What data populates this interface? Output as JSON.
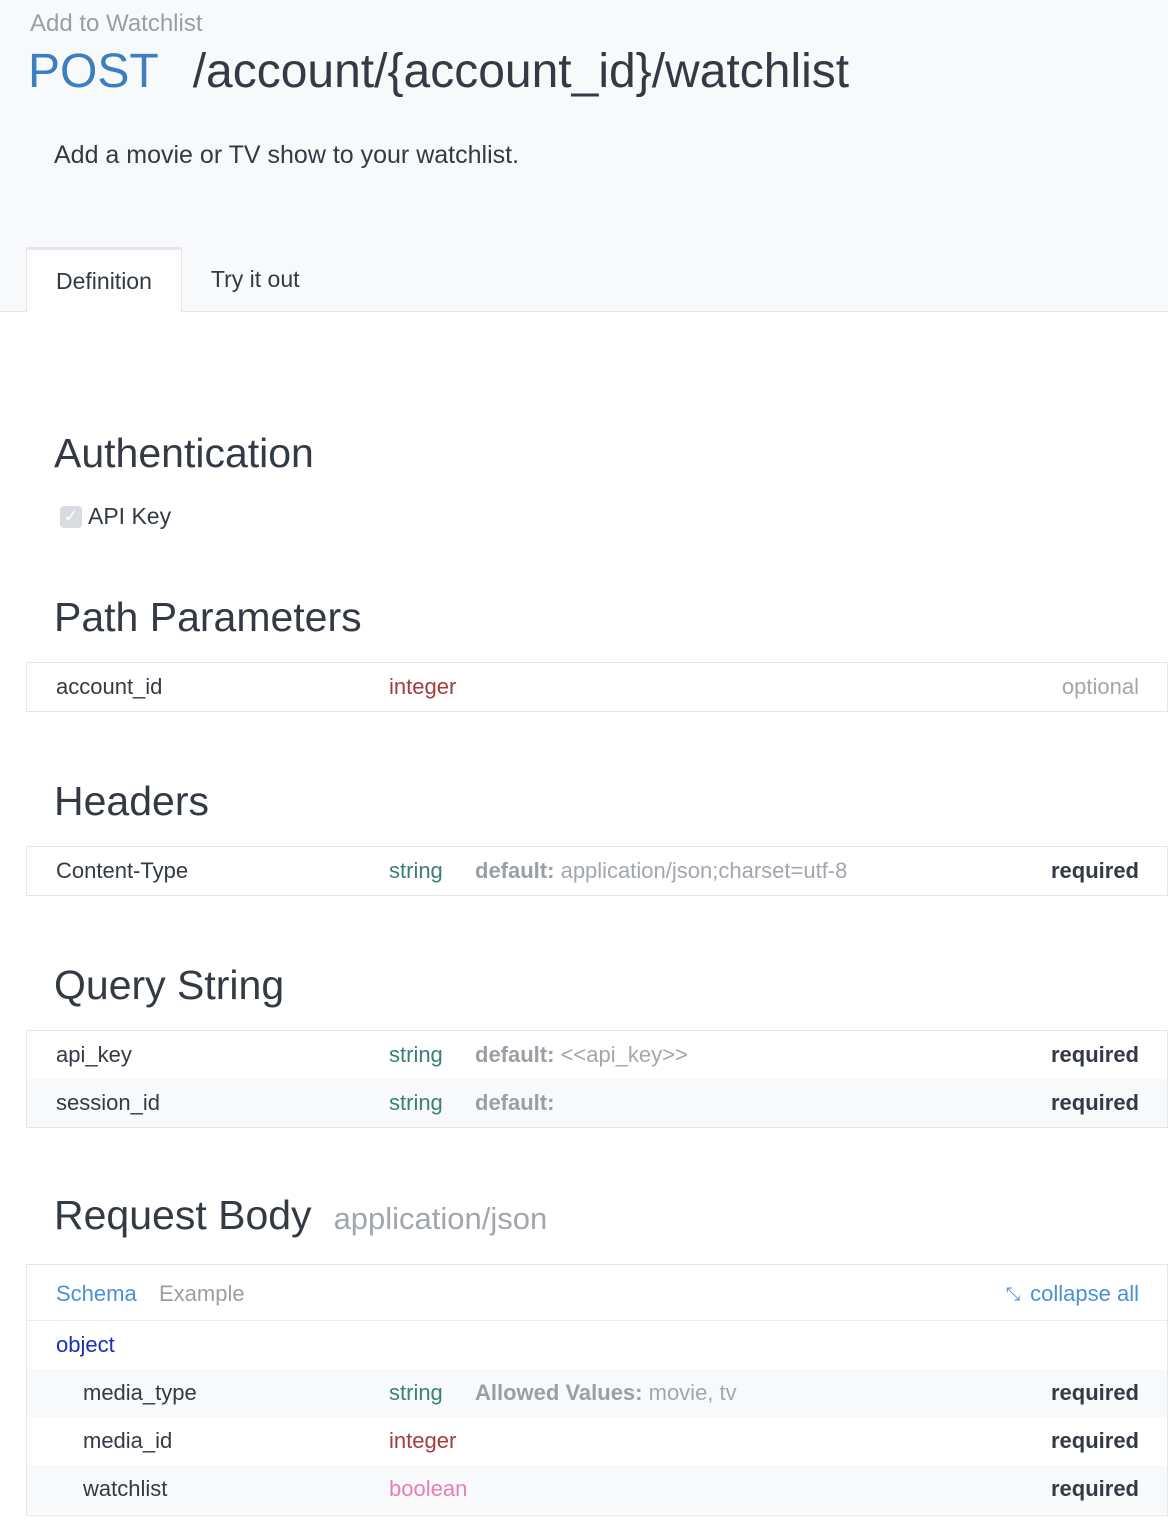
{
  "breadcrumb": "Add to Watchlist",
  "endpoint": {
    "method": "POST",
    "path": "/account/{account_id}/watchlist"
  },
  "description": "Add a movie or TV show to your watchlist.",
  "tabs": [
    {
      "label": "Definition",
      "active": true
    },
    {
      "label": "Try it out",
      "active": false
    }
  ],
  "authentication": {
    "title": "Authentication",
    "item": "API Key"
  },
  "path_parameters": {
    "title": "Path Parameters",
    "rows": [
      {
        "name": "account_id",
        "type": "integer",
        "default_label": "",
        "default_value": "",
        "status": "optional"
      }
    ]
  },
  "headers": {
    "title": "Headers",
    "rows": [
      {
        "name": "Content-Type",
        "type": "string",
        "default_label": "default:",
        "default_value": "application/json;charset=utf-8",
        "status": "required"
      }
    ]
  },
  "query_string": {
    "title": "Query String",
    "rows": [
      {
        "name": "api_key",
        "type": "string",
        "default_label": "default:",
        "default_value": "<<api_key>>",
        "status": "required"
      },
      {
        "name": "session_id",
        "type": "string",
        "default_label": "default:",
        "default_value": "",
        "status": "required"
      }
    ]
  },
  "request_body": {
    "title": "Request Body",
    "content_type": "application/json",
    "schema_tab": "Schema",
    "example_tab": "Example",
    "collapse_all": "collapse all",
    "object_label": "object",
    "fields": [
      {
        "name": "media_type",
        "type": "string",
        "allowed_label": "Allowed Values:",
        "allowed_values": "movie, tv",
        "status": "required"
      },
      {
        "name": "media_id",
        "type": "integer",
        "allowed_label": "",
        "allowed_values": "",
        "status": "required"
      },
      {
        "name": "watchlist",
        "type": "boolean",
        "allowed_label": "",
        "allowed_values": "",
        "status": "required"
      }
    ]
  },
  "colors": {
    "method": "#3c7ebf",
    "link": "#4a90d9",
    "type_integer": "#a33d3d",
    "type_string": "#3c8078",
    "type_boolean": "#e57fb6",
    "object": "#1a2fb8"
  }
}
